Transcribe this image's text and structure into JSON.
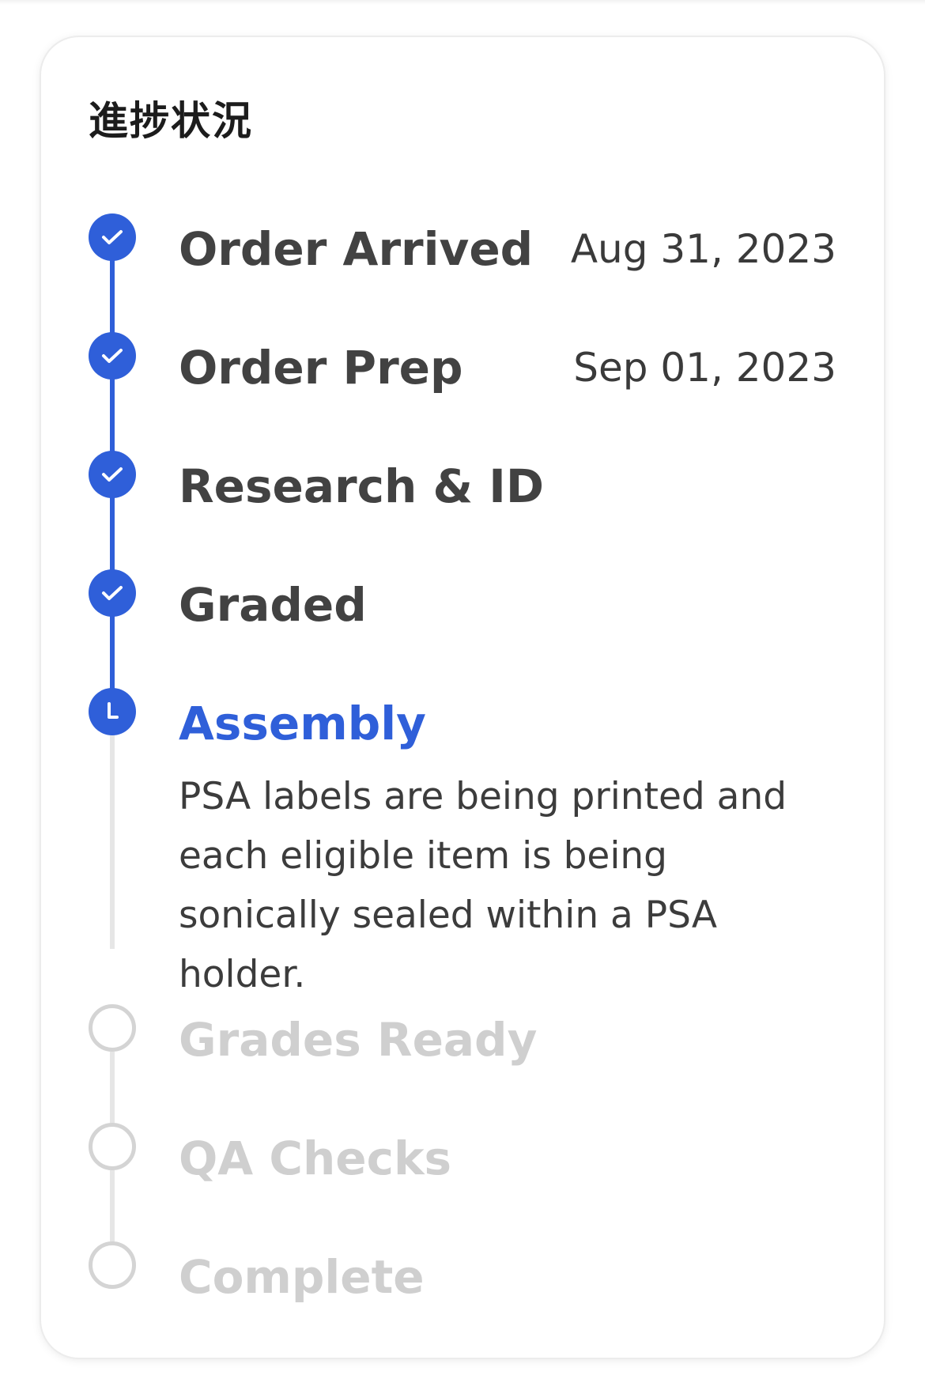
{
  "card": {
    "title": "進捗状況"
  },
  "steps": [
    {
      "label": "Order Arrived",
      "date": "Aug 31, 2023",
      "status": "done",
      "icon": "check-icon"
    },
    {
      "label": "Order Prep",
      "date": "Sep 01, 2023",
      "status": "done",
      "icon": "check-icon"
    },
    {
      "label": "Research & ID",
      "status": "done",
      "icon": "check-icon"
    },
    {
      "label": "Graded",
      "status": "done",
      "icon": "check-icon"
    },
    {
      "label": "Assembly",
      "status": "current",
      "icon": "clock-icon",
      "description": "PSA labels are being printed and each eligible item is being sonically sealed within a PSA holder."
    },
    {
      "label": "Grades Ready",
      "status": "todo",
      "icon": "empty-circle-icon"
    },
    {
      "label": "QA Checks",
      "status": "todo",
      "icon": "empty-circle-icon"
    },
    {
      "label": "Complete",
      "status": "todo",
      "icon": "empty-circle-icon"
    }
  ],
  "colors": {
    "accent": "#2f5fd9",
    "done_text": "#424242",
    "todo_text": "#cfcfcf",
    "todo_circle": "#d4d4d4",
    "rail_todo": "#e6e6e6"
  }
}
